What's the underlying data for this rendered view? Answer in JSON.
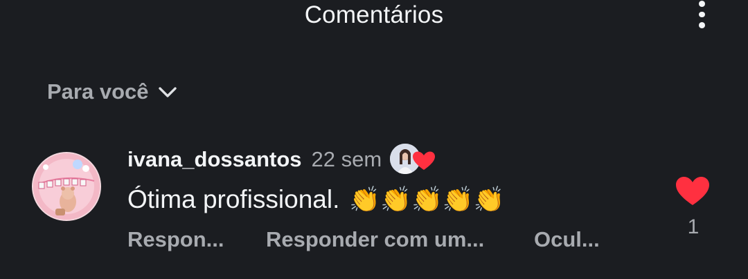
{
  "header": {
    "title": "Comentários",
    "more_icon": "more-vertical-icon"
  },
  "filter": {
    "label": "Para você",
    "icon": "chevron-down-icon"
  },
  "comment": {
    "username": "ivana_dossantos",
    "time": "22 sem",
    "text": "Ótima profissional.",
    "emojis": "👏👏👏👏👏",
    "liked_by_author_icon": "heart-icon",
    "actions": {
      "reply": "Respon...",
      "reply_with": "Responder com um...",
      "hide": "Ocul..."
    },
    "like_count": "1",
    "like_color": "#ff3040"
  }
}
